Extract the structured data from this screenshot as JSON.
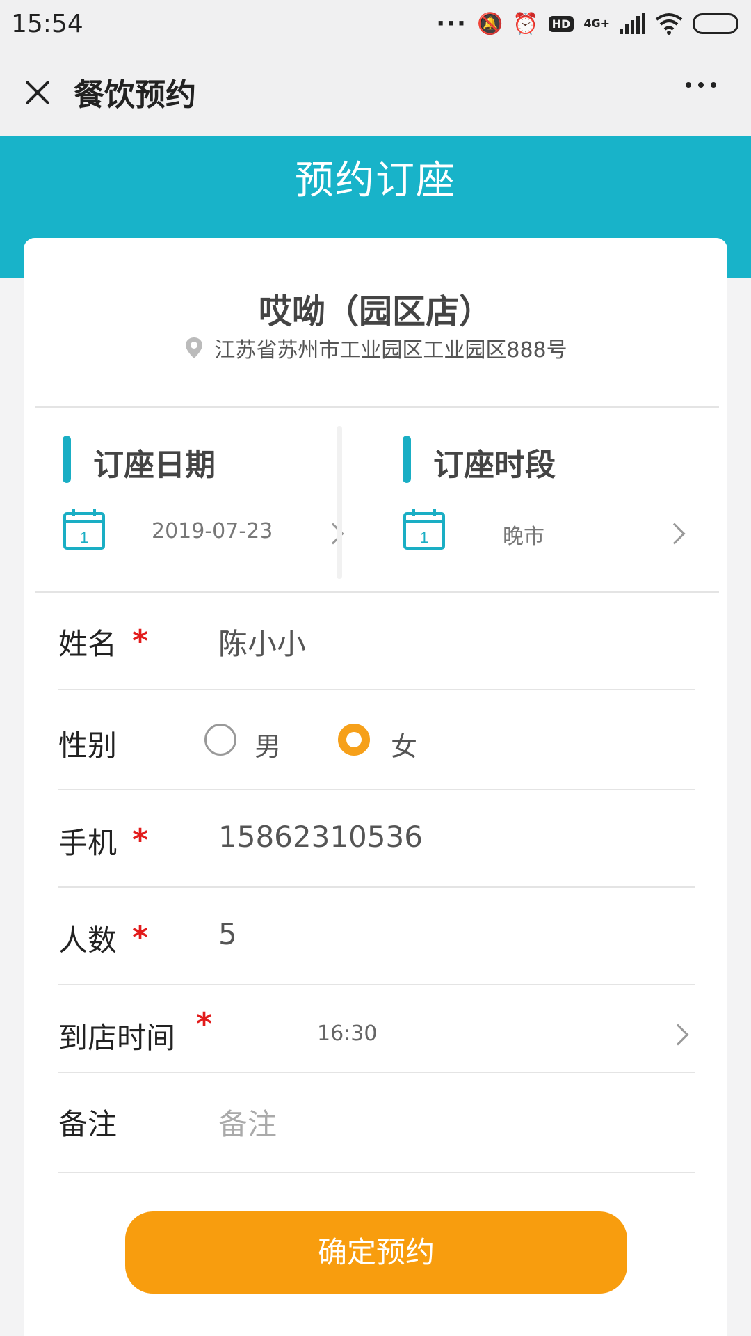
{
  "status_bar": {
    "time": "15:54",
    "network": "4G+",
    "hd": "HD"
  },
  "nav": {
    "title": "餐饮预约"
  },
  "header": {
    "title": "预约订座"
  },
  "shop": {
    "name": "哎呦（园区店）",
    "address": "江苏省苏州市工业园区工业园区888号"
  },
  "booking": {
    "date": {
      "label": "订座日期",
      "value": "2019-07-23"
    },
    "period": {
      "label": "订座时段",
      "value": "晚市"
    }
  },
  "form": {
    "name": {
      "label": "姓名",
      "value": "陈小小",
      "required": "*"
    },
    "gender": {
      "label": "性别",
      "options": [
        "男",
        "女"
      ],
      "selected": "女"
    },
    "phone": {
      "label": "手机",
      "value": "15862310536",
      "required": "*"
    },
    "people": {
      "label": "人数",
      "value": "5",
      "required": "*"
    },
    "arrival": {
      "label": "到店时间",
      "value": "16:30",
      "required": "*"
    },
    "note": {
      "label": "备注",
      "placeholder": "备注"
    }
  },
  "submit": {
    "label": "确定预约"
  },
  "colors": {
    "teal": "#18b3c9",
    "orange": "#f89d0e",
    "required": "#e21b1b"
  }
}
